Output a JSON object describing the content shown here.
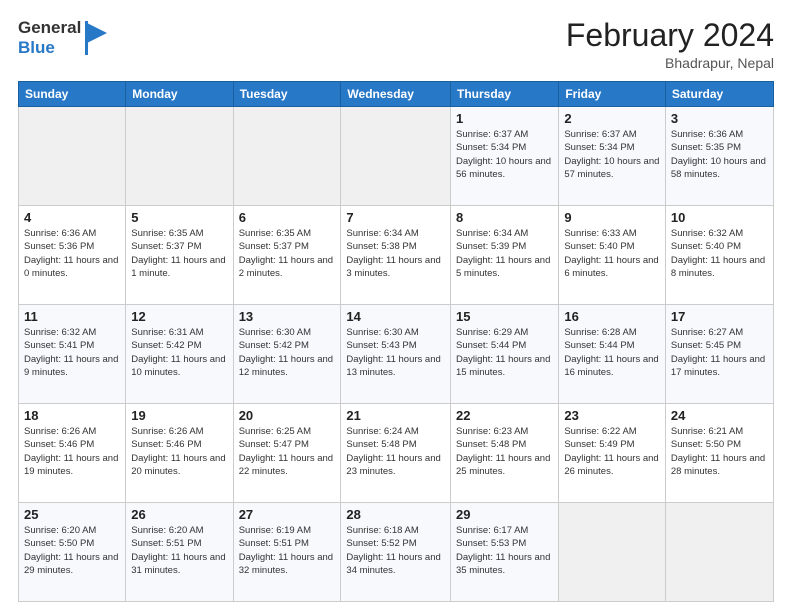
{
  "header": {
    "logo_general": "General",
    "logo_blue": "Blue",
    "title": "February 2024",
    "subtitle": "Bhadrapur, Nepal"
  },
  "days_of_week": [
    "Sunday",
    "Monday",
    "Tuesday",
    "Wednesday",
    "Thursday",
    "Friday",
    "Saturday"
  ],
  "weeks": [
    [
      {
        "day": "",
        "sunrise": "",
        "sunset": "",
        "daylight": ""
      },
      {
        "day": "",
        "sunrise": "",
        "sunset": "",
        "daylight": ""
      },
      {
        "day": "",
        "sunrise": "",
        "sunset": "",
        "daylight": ""
      },
      {
        "day": "",
        "sunrise": "",
        "sunset": "",
        "daylight": ""
      },
      {
        "day": "1",
        "sunrise": "Sunrise: 6:37 AM",
        "sunset": "Sunset: 5:34 PM",
        "daylight": "Daylight: 10 hours and 56 minutes."
      },
      {
        "day": "2",
        "sunrise": "Sunrise: 6:37 AM",
        "sunset": "Sunset: 5:34 PM",
        "daylight": "Daylight: 10 hours and 57 minutes."
      },
      {
        "day": "3",
        "sunrise": "Sunrise: 6:36 AM",
        "sunset": "Sunset: 5:35 PM",
        "daylight": "Daylight: 10 hours and 58 minutes."
      }
    ],
    [
      {
        "day": "4",
        "sunrise": "Sunrise: 6:36 AM",
        "sunset": "Sunset: 5:36 PM",
        "daylight": "Daylight: 11 hours and 0 minutes."
      },
      {
        "day": "5",
        "sunrise": "Sunrise: 6:35 AM",
        "sunset": "Sunset: 5:37 PM",
        "daylight": "Daylight: 11 hours and 1 minute."
      },
      {
        "day": "6",
        "sunrise": "Sunrise: 6:35 AM",
        "sunset": "Sunset: 5:37 PM",
        "daylight": "Daylight: 11 hours and 2 minutes."
      },
      {
        "day": "7",
        "sunrise": "Sunrise: 6:34 AM",
        "sunset": "Sunset: 5:38 PM",
        "daylight": "Daylight: 11 hours and 3 minutes."
      },
      {
        "day": "8",
        "sunrise": "Sunrise: 6:34 AM",
        "sunset": "Sunset: 5:39 PM",
        "daylight": "Daylight: 11 hours and 5 minutes."
      },
      {
        "day": "9",
        "sunrise": "Sunrise: 6:33 AM",
        "sunset": "Sunset: 5:40 PM",
        "daylight": "Daylight: 11 hours and 6 minutes."
      },
      {
        "day": "10",
        "sunrise": "Sunrise: 6:32 AM",
        "sunset": "Sunset: 5:40 PM",
        "daylight": "Daylight: 11 hours and 8 minutes."
      }
    ],
    [
      {
        "day": "11",
        "sunrise": "Sunrise: 6:32 AM",
        "sunset": "Sunset: 5:41 PM",
        "daylight": "Daylight: 11 hours and 9 minutes."
      },
      {
        "day": "12",
        "sunrise": "Sunrise: 6:31 AM",
        "sunset": "Sunset: 5:42 PM",
        "daylight": "Daylight: 11 hours and 10 minutes."
      },
      {
        "day": "13",
        "sunrise": "Sunrise: 6:30 AM",
        "sunset": "Sunset: 5:42 PM",
        "daylight": "Daylight: 11 hours and 12 minutes."
      },
      {
        "day": "14",
        "sunrise": "Sunrise: 6:30 AM",
        "sunset": "Sunset: 5:43 PM",
        "daylight": "Daylight: 11 hours and 13 minutes."
      },
      {
        "day": "15",
        "sunrise": "Sunrise: 6:29 AM",
        "sunset": "Sunset: 5:44 PM",
        "daylight": "Daylight: 11 hours and 15 minutes."
      },
      {
        "day": "16",
        "sunrise": "Sunrise: 6:28 AM",
        "sunset": "Sunset: 5:44 PM",
        "daylight": "Daylight: 11 hours and 16 minutes."
      },
      {
        "day": "17",
        "sunrise": "Sunrise: 6:27 AM",
        "sunset": "Sunset: 5:45 PM",
        "daylight": "Daylight: 11 hours and 17 minutes."
      }
    ],
    [
      {
        "day": "18",
        "sunrise": "Sunrise: 6:26 AM",
        "sunset": "Sunset: 5:46 PM",
        "daylight": "Daylight: 11 hours and 19 minutes."
      },
      {
        "day": "19",
        "sunrise": "Sunrise: 6:26 AM",
        "sunset": "Sunset: 5:46 PM",
        "daylight": "Daylight: 11 hours and 20 minutes."
      },
      {
        "day": "20",
        "sunrise": "Sunrise: 6:25 AM",
        "sunset": "Sunset: 5:47 PM",
        "daylight": "Daylight: 11 hours and 22 minutes."
      },
      {
        "day": "21",
        "sunrise": "Sunrise: 6:24 AM",
        "sunset": "Sunset: 5:48 PM",
        "daylight": "Daylight: 11 hours and 23 minutes."
      },
      {
        "day": "22",
        "sunrise": "Sunrise: 6:23 AM",
        "sunset": "Sunset: 5:48 PM",
        "daylight": "Daylight: 11 hours and 25 minutes."
      },
      {
        "day": "23",
        "sunrise": "Sunrise: 6:22 AM",
        "sunset": "Sunset: 5:49 PM",
        "daylight": "Daylight: 11 hours and 26 minutes."
      },
      {
        "day": "24",
        "sunrise": "Sunrise: 6:21 AM",
        "sunset": "Sunset: 5:50 PM",
        "daylight": "Daylight: 11 hours and 28 minutes."
      }
    ],
    [
      {
        "day": "25",
        "sunrise": "Sunrise: 6:20 AM",
        "sunset": "Sunset: 5:50 PM",
        "daylight": "Daylight: 11 hours and 29 minutes."
      },
      {
        "day": "26",
        "sunrise": "Sunrise: 6:20 AM",
        "sunset": "Sunset: 5:51 PM",
        "daylight": "Daylight: 11 hours and 31 minutes."
      },
      {
        "day": "27",
        "sunrise": "Sunrise: 6:19 AM",
        "sunset": "Sunset: 5:51 PM",
        "daylight": "Daylight: 11 hours and 32 minutes."
      },
      {
        "day": "28",
        "sunrise": "Sunrise: 6:18 AM",
        "sunset": "Sunset: 5:52 PM",
        "daylight": "Daylight: 11 hours and 34 minutes."
      },
      {
        "day": "29",
        "sunrise": "Sunrise: 6:17 AM",
        "sunset": "Sunset: 5:53 PM",
        "daylight": "Daylight: 11 hours and 35 minutes."
      },
      {
        "day": "",
        "sunrise": "",
        "sunset": "",
        "daylight": ""
      },
      {
        "day": "",
        "sunrise": "",
        "sunset": "",
        "daylight": ""
      }
    ]
  ]
}
